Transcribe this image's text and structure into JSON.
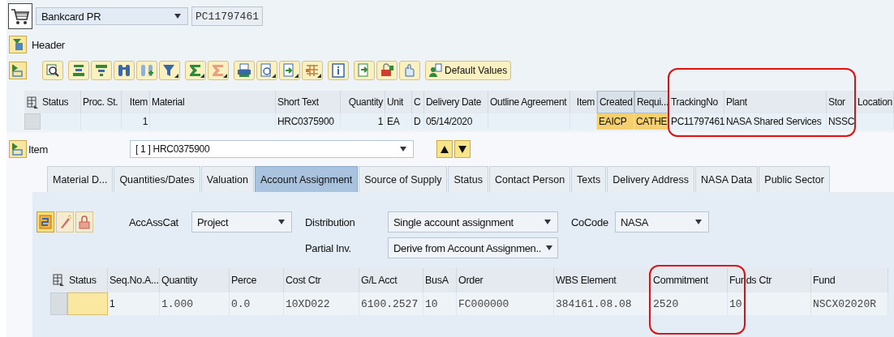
{
  "document_bar": {
    "doc_type": "Bankcard PR",
    "doc_number": "PC11797461"
  },
  "header_section": {
    "label": "Header"
  },
  "toolbar": {
    "text_button": "Default Values"
  },
  "items_table": {
    "columns": [
      {
        "label": "Status",
        "kind": "text"
      },
      {
        "label": "Proc. St.",
        "kind": "text"
      },
      {
        "label": "Item",
        "kind": "num"
      },
      {
        "label": "Material",
        "kind": "text"
      },
      {
        "label": "Short Text",
        "kind": "text"
      },
      {
        "label": "Quantity",
        "kind": "num"
      },
      {
        "label": "Unit",
        "kind": "text"
      },
      {
        "label": "C",
        "kind": "text"
      },
      {
        "label": "Delivery Date",
        "kind": "text"
      },
      {
        "label": "Outline Agreement",
        "kind": "text"
      },
      {
        "label": "Item",
        "kind": "num"
      },
      {
        "label": "Created",
        "kind": "flag"
      },
      {
        "label": "Requi...",
        "kind": "flag"
      },
      {
        "label": "TrackingNo",
        "kind": "text"
      },
      {
        "label": "Plant",
        "kind": "text"
      },
      {
        "label": "Stor",
        "kind": "text"
      },
      {
        "label": "Location",
        "kind": "text"
      }
    ],
    "rows": [
      {
        "cells": [
          null,
          null,
          "1",
          null,
          "HRC0375900",
          "1",
          "EA",
          "D",
          "05/14/2020",
          null,
          null,
          "EAICP",
          "CATHE",
          "PC11797461",
          "NASA Shared Services",
          "NSSC",
          null
        ]
      }
    ]
  },
  "item_section": {
    "label": "Item",
    "selected_item": "[ 1 ] HRC0375900"
  },
  "tabs": [
    {
      "label": "Material D...",
      "selected": false
    },
    {
      "label": "Quantities/Dates",
      "selected": false
    },
    {
      "label": "Valuation",
      "selected": false
    },
    {
      "label": "Account Assignment",
      "selected": true
    },
    {
      "label": "Source of Supply",
      "selected": false
    },
    {
      "label": "Status",
      "selected": false
    },
    {
      "label": "Contact Person",
      "selected": false
    },
    {
      "label": "Texts",
      "selected": false
    },
    {
      "label": "Delivery Address",
      "selected": false
    },
    {
      "label": "NASA Data",
      "selected": false
    },
    {
      "label": "Public Sector",
      "selected": false
    }
  ],
  "assignment_form": {
    "fields": [
      {
        "label": "AccAssCat",
        "value": "Project"
      },
      {
        "label": "Distribution",
        "value": "Single account assignment"
      },
      {
        "label": "CoCode",
        "value": "NASA"
      },
      {
        "label": "Partial Inv.",
        "value": "Derive from Account Assignmen.."
      }
    ]
  },
  "assignment_table": {
    "columns": [
      {
        "label": "Status",
        "kind": "flag"
      },
      {
        "label": "Seq.No.A...",
        "kind": "text"
      },
      {
        "label": "Quantity",
        "kind": "mono"
      },
      {
        "label": "Perce",
        "kind": "mono"
      },
      {
        "label": "Cost Ctr",
        "kind": "mono"
      },
      {
        "label": "G/L Acct",
        "kind": "mono"
      },
      {
        "label": "BusA",
        "kind": "mono"
      },
      {
        "label": "Order",
        "kind": "mono"
      },
      {
        "label": "WBS Element",
        "kind": "mono"
      },
      {
        "label": "Commitment",
        "kind": "mono"
      },
      {
        "label": "Funds Ctr",
        "kind": "mono"
      },
      {
        "label": "Fund",
        "kind": "mono"
      }
    ],
    "rows": [
      {
        "cells": [
          null,
          "1",
          "1.000",
          "0.0",
          "10XD022",
          "6100.2527",
          "10",
          "FC000000",
          "384161.08.08",
          "2520",
          "10",
          "NSCX02020R"
        ]
      }
    ]
  }
}
